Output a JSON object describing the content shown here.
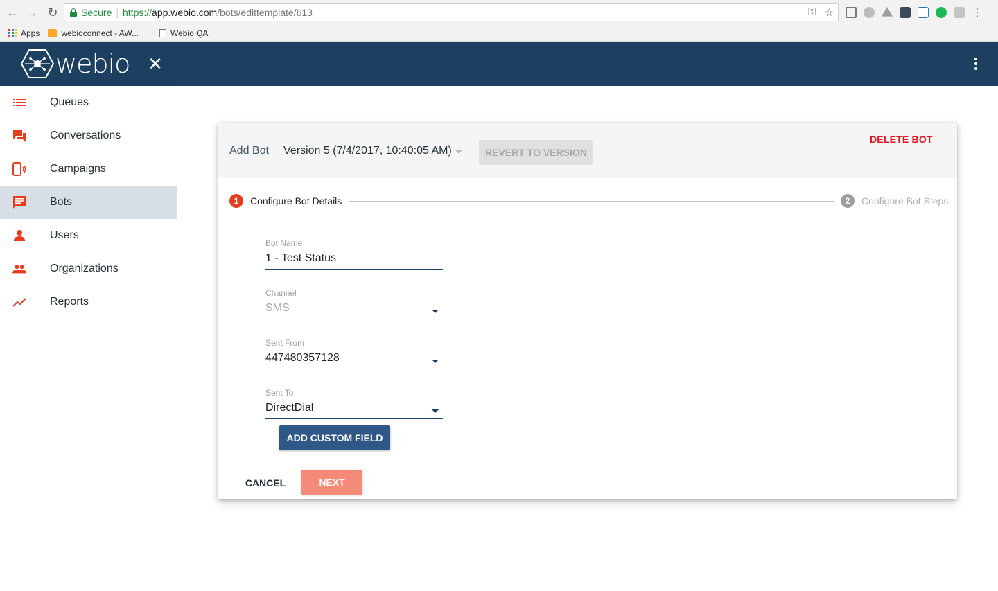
{
  "browser": {
    "secure_label": "Secure",
    "url_scheme": "https://",
    "url_host": "app.webio.com",
    "url_path": "/bots/edittemplate/613",
    "bookmarks": [
      "Apps",
      "webioconnect - AW...",
      "Webio QA"
    ]
  },
  "header": {
    "brand_name": "webio",
    "close_glyph": "✕"
  },
  "sidebar": {
    "items": [
      {
        "label": "Queues",
        "icon": "queue-list-icon",
        "active": false
      },
      {
        "label": "Conversations",
        "icon": "chat-bubbles-icon",
        "active": false
      },
      {
        "label": "Campaigns",
        "icon": "phone-broadcast-icon",
        "active": false
      },
      {
        "label": "Bots",
        "icon": "message-lines-icon",
        "active": true
      },
      {
        "label": "Users",
        "icon": "person-icon",
        "active": false
      },
      {
        "label": "Organizations",
        "icon": "people-icon",
        "active": false
      },
      {
        "label": "Reports",
        "icon": "trend-line-icon",
        "active": false
      }
    ]
  },
  "card": {
    "title": "Add Bot",
    "version_selected": "Version 5 (7/4/2017, 10:40:05 AM)",
    "revert_label": "REVERT TO VERSION",
    "delete_label": "DELETE BOT"
  },
  "stepper": {
    "step1_number": "1",
    "step1_label": "Configure Bot Details",
    "step2_number": "2",
    "step2_label": "Configure Bot Steps"
  },
  "form": {
    "bot_name_label": "Bot Name",
    "bot_name_value": "1 - Test Status",
    "channel_label": "Channel",
    "channel_value": "SMS",
    "sent_from_label": "Sent From",
    "sent_from_value": "447480357128",
    "sent_to_label": "Sent To",
    "sent_to_value": "DirectDial",
    "add_custom_field_label": "ADD CUSTOM FIELD",
    "cancel_label": "CANCEL",
    "next_label": "NEXT"
  },
  "colors": {
    "header": "#1d3f60",
    "accent": "#e73d1c",
    "primary_button": "#2f5787",
    "next_button": "#f58a79",
    "delete": "#e8101c",
    "sidebar_active": "#d7dee5"
  }
}
